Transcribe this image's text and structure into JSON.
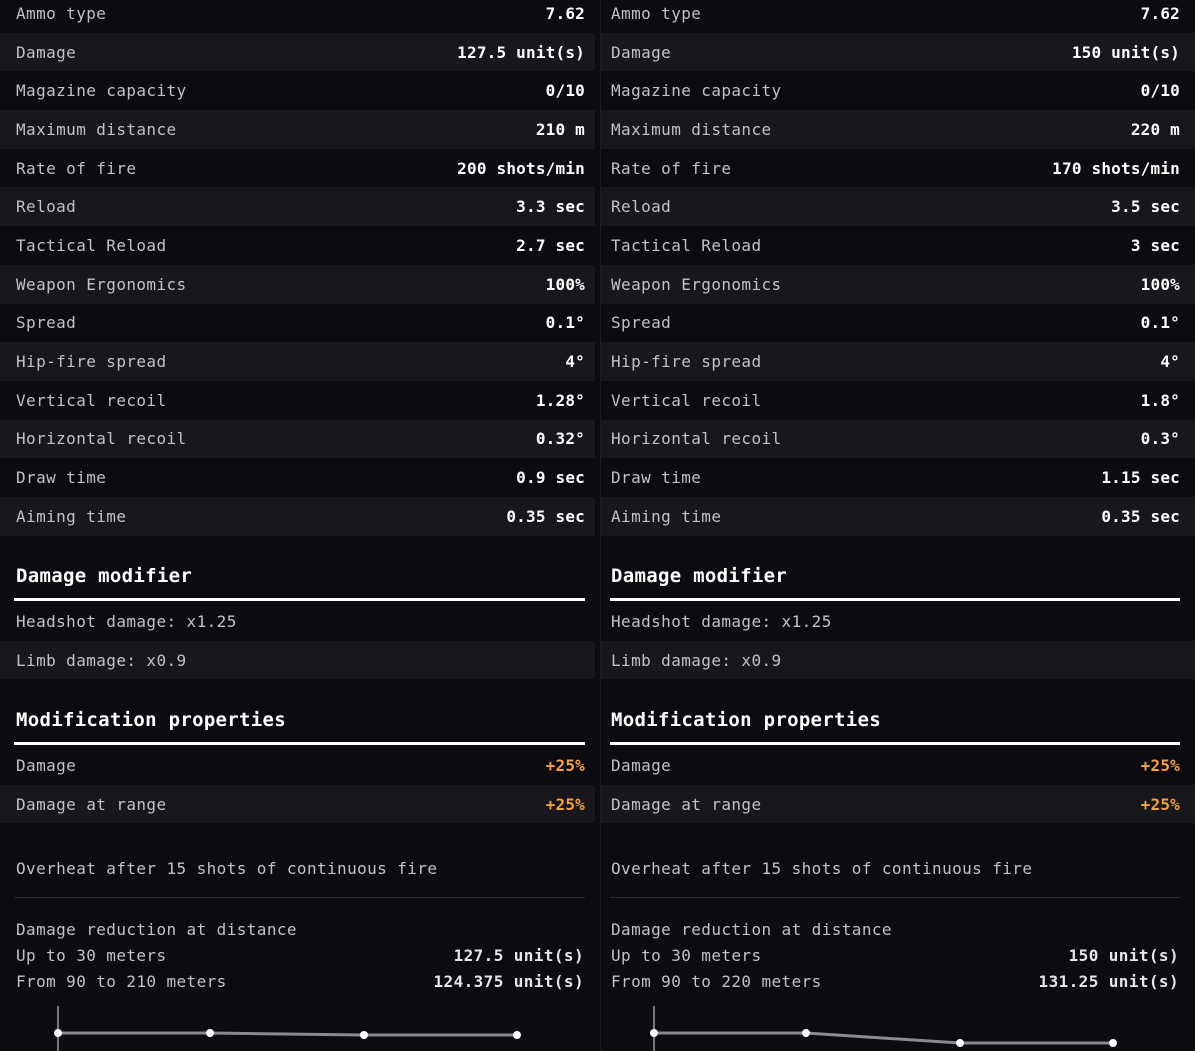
{
  "columns": [
    {
      "stats": [
        {
          "label": "Ammo type",
          "value": "7.62"
        },
        {
          "label": "Damage",
          "value": "127.5 unit(s)"
        },
        {
          "label": "Magazine capacity",
          "value": "0/10"
        },
        {
          "label": "Maximum distance",
          "value": "210 m"
        },
        {
          "label": "Rate of fire",
          "value": "200 shots/min"
        },
        {
          "label": "Reload",
          "value": "3.3 sec"
        },
        {
          "label": "Tactical Reload",
          "value": "2.7 sec"
        },
        {
          "label": "Weapon Ergonomics",
          "value": "100%"
        },
        {
          "label": "Spread",
          "value": "0.1°"
        },
        {
          "label": "Hip-fire spread",
          "value": "4°"
        },
        {
          "label": "Vertical recoil",
          "value": "1.28°"
        },
        {
          "label": "Horizontal recoil",
          "value": "0.32°"
        },
        {
          "label": "Draw time",
          "value": "0.9 sec"
        },
        {
          "label": "Aiming time",
          "value": "0.35 sec"
        }
      ],
      "damage_modifier": {
        "title": "Damage modifier",
        "items": [
          "Headshot damage: x1.25",
          "Limb damage: x0.9"
        ]
      },
      "modification": {
        "title": "Modification properties",
        "items": [
          {
            "label": "Damage",
            "value": "+25%"
          },
          {
            "label": "Damage at range",
            "value": "+25%"
          }
        ]
      },
      "overheat": "Overheat after 15 shots of continuous fire",
      "damage_reduction": {
        "title": "Damage reduction at distance",
        "lines": [
          {
            "label": "Up to 30 meters",
            "value": "127.5 unit(s)"
          },
          {
            "label": "From 90 to 210 meters",
            "value": "124.375 unit(s)"
          }
        ],
        "curve": [
          1.0,
          1.0,
          0.975,
          0.975
        ]
      }
    },
    {
      "stats": [
        {
          "label": "Ammo type",
          "value": "7.62"
        },
        {
          "label": "Damage",
          "value": "150 unit(s)"
        },
        {
          "label": "Magazine capacity",
          "value": "0/10"
        },
        {
          "label": "Maximum distance",
          "value": "220 m"
        },
        {
          "label": "Rate of fire",
          "value": "170 shots/min"
        },
        {
          "label": "Reload",
          "value": "3.5 sec"
        },
        {
          "label": "Tactical Reload",
          "value": "3 sec"
        },
        {
          "label": "Weapon Ergonomics",
          "value": "100%"
        },
        {
          "label": "Spread",
          "value": "0.1°"
        },
        {
          "label": "Hip-fire spread",
          "value": "4°"
        },
        {
          "label": "Vertical recoil",
          "value": "1.8°"
        },
        {
          "label": "Horizontal recoil",
          "value": "0.3°"
        },
        {
          "label": "Draw time",
          "value": "1.15 sec"
        },
        {
          "label": "Aiming time",
          "value": "0.35 sec"
        }
      ],
      "damage_modifier": {
        "title": "Damage modifier",
        "items": [
          "Headshot damage: x1.25",
          "Limb damage: x0.9"
        ]
      },
      "modification": {
        "title": "Modification properties",
        "items": [
          {
            "label": "Damage",
            "value": "+25%"
          },
          {
            "label": "Damage at range",
            "value": "+25%"
          }
        ]
      },
      "overheat": "Overheat after 15 shots of continuous fire",
      "damage_reduction": {
        "title": "Damage reduction at distance",
        "lines": [
          {
            "label": "Up to 30 meters",
            "value": "150 unit(s)"
          },
          {
            "label": "From 90 to 220 meters",
            "value": "131.25 unit(s)"
          }
        ],
        "curve": [
          1.0,
          1.0,
          0.875,
          0.875
        ]
      }
    }
  ],
  "colors": {
    "background": "#0c0c10",
    "row_alt": "#17171c",
    "accent": "#f5a23c",
    "text": "#c2c2c6",
    "value": "#ffffff"
  }
}
